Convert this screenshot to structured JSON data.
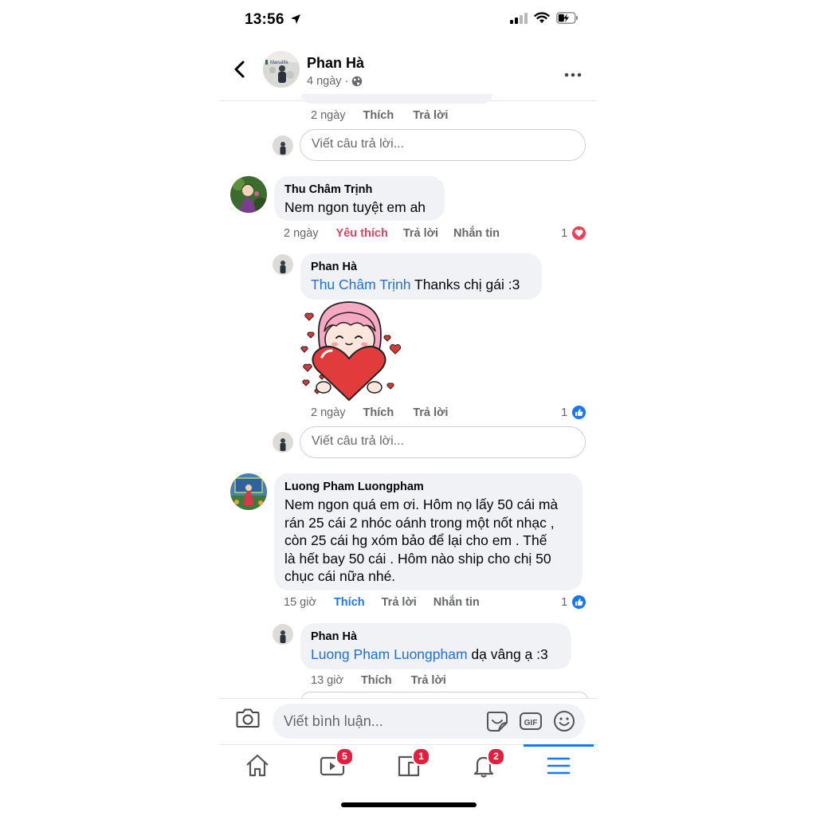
{
  "status_bar": {
    "time": "13:56"
  },
  "post_header": {
    "name": "Phan Hà",
    "meta": "4 ngày · ",
    "avatar_text": "Manulife"
  },
  "colors": {
    "accent": "#1877f2",
    "love": "#e4405f",
    "mention": "#216fdb",
    "badge": "#e41e3f",
    "bubble": "#f0f2f5"
  },
  "thread": {
    "top_reply_actions": {
      "time": "2 ngày",
      "like": "Thích",
      "reply": "Trả lời"
    },
    "reply_input_1": {
      "placeholder": "Viết câu trả lời..."
    },
    "comment_1": {
      "author": "Thu Châm Trịnh",
      "text": "Nem ngon tuyệt em ah",
      "time": "2 ngày",
      "like": "Yêu thích",
      "reply": "Trả lời",
      "message": "Nhắn tin",
      "reaction_count": "1",
      "reaction_icon": "love-reaction-icon"
    },
    "reply_1": {
      "author": "Phan Hà",
      "mention": "Thu Châm Trịnh",
      "text": " Thanks chị gái :3",
      "sticker": "heart-girl-sticker",
      "time": "2 ngày",
      "like": "Thích",
      "reply": "Trả lời",
      "reaction_count": "1",
      "reaction_icon": "like-reaction-icon"
    },
    "reply_input_2": {
      "placeholder": "Viết câu trả lời..."
    },
    "comment_2": {
      "author": "Luong Pham Luongpham",
      "lines": [
        "Nem ngon quá em ơi. Hôm nọ lấy 50 cái mà",
        "rán 25 cái 2 nhóc oánh trong một nốt nhạc ,",
        "còn 25 cái hg xóm bảo để lại cho em . Thế",
        "là hết bay 50 cái . Hôm nào ship cho chị 50",
        "chục cái nữa nhé."
      ],
      "time": "15 giờ",
      "like": "Thích",
      "reply": "Trả lời",
      "message": "Nhắn tin",
      "reaction_count": "1",
      "reaction_icon": "like-reaction-icon"
    },
    "reply_2": {
      "author": "Phan Hà",
      "mention": "Luong Pham Luongpham",
      "text": " dạ vâng ạ :3",
      "time": "13 giờ",
      "like": "Thích",
      "reply": "Trả lời"
    }
  },
  "composer": {
    "placeholder": "Viết bình luận..."
  },
  "bottom_nav": {
    "items": [
      {
        "name": "home",
        "badge": ""
      },
      {
        "name": "watch",
        "badge": "5"
      },
      {
        "name": "pages",
        "badge": "1"
      },
      {
        "name": "notifications",
        "badge": "2"
      },
      {
        "name": "menu",
        "badge": ""
      }
    ]
  }
}
